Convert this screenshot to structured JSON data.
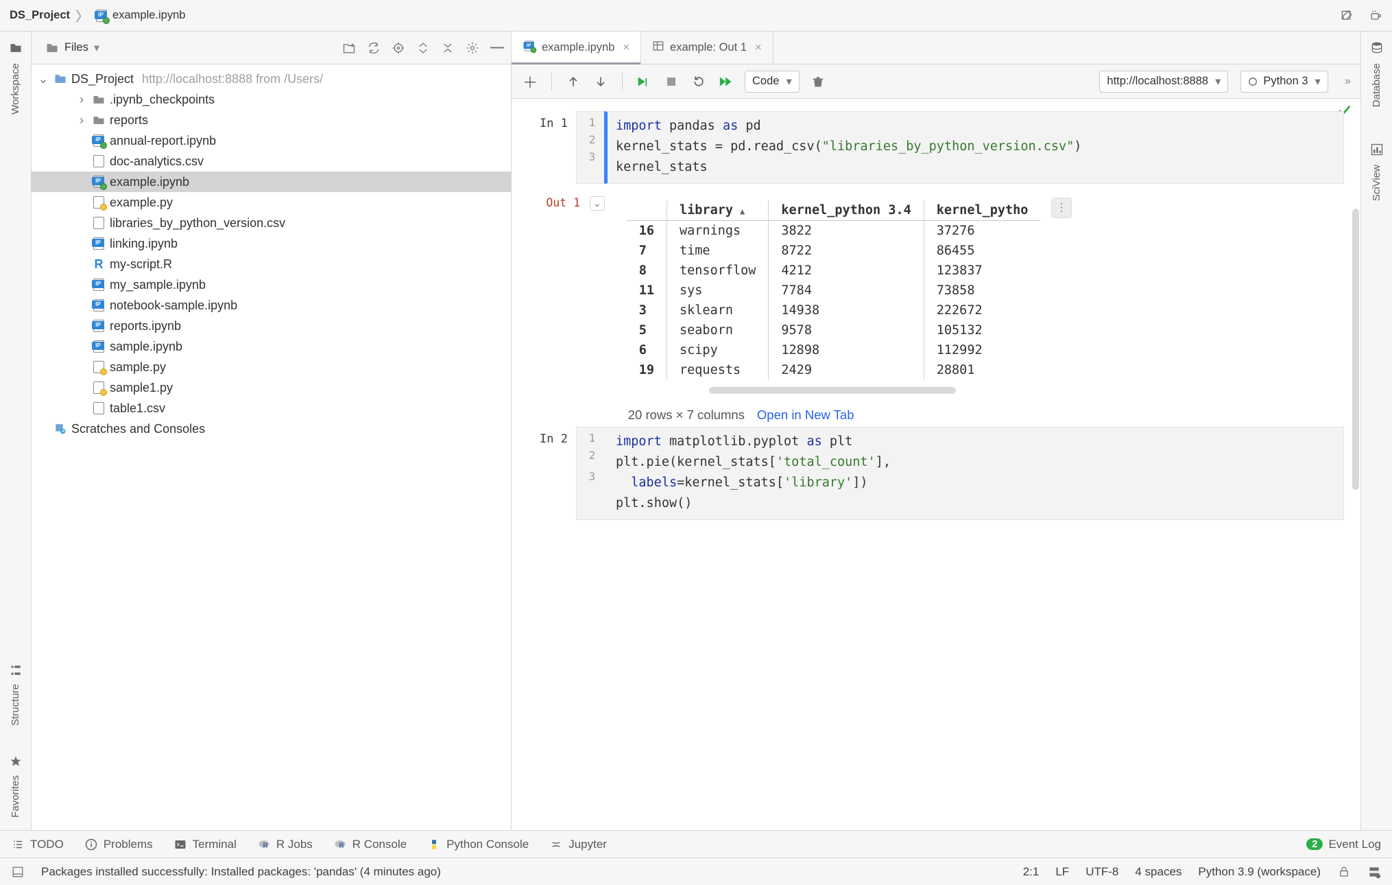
{
  "breadcrumbs": {
    "project": "DS_Project",
    "file": "example.ipynb"
  },
  "nav_icons": {
    "edit": "edit-icon",
    "tea": "tea-icon"
  },
  "left_gutter": [
    {
      "icon": "folder-icon",
      "label": "Workspace"
    },
    {
      "icon": "structure-icon",
      "label": "Structure"
    },
    {
      "icon": "star-icon",
      "label": "Favorites"
    }
  ],
  "right_gutter": [
    {
      "icon": "db-icon",
      "label": "Database"
    },
    {
      "icon": "sci-icon",
      "label": "SciView"
    }
  ],
  "files_panel": {
    "selector": "Files",
    "toolbar_icons": [
      "new-file-icon",
      "sync-icon",
      "target-icon",
      "expand-icon",
      "collapse-icon",
      "gear-icon",
      "hide-icon"
    ],
    "root": {
      "name": "DS_Project",
      "subtitle": "http://localhost:8888 from /Users/"
    },
    "tree": [
      {
        "type": "folder",
        "depth": 1,
        "name": ".ipynb_checkpoints",
        "arrow": "right"
      },
      {
        "type": "folder",
        "depth": 1,
        "name": "reports",
        "arrow": "right"
      },
      {
        "type": "ipynb-live",
        "depth": 1,
        "name": "annual-report.ipynb"
      },
      {
        "type": "csv",
        "depth": 1,
        "name": "doc-analytics.csv"
      },
      {
        "type": "ipynb-live",
        "depth": 1,
        "name": "example.ipynb",
        "selected": true
      },
      {
        "type": "py",
        "depth": 1,
        "name": "example.py"
      },
      {
        "type": "csv",
        "depth": 1,
        "name": "libraries_by_python_version.csv"
      },
      {
        "type": "ipynb",
        "depth": 1,
        "name": "linking.ipynb"
      },
      {
        "type": "r",
        "depth": 1,
        "name": "my-script.R"
      },
      {
        "type": "ipynb",
        "depth": 1,
        "name": "my_sample.ipynb"
      },
      {
        "type": "ipynb",
        "depth": 1,
        "name": "notebook-sample.ipynb"
      },
      {
        "type": "ipynb",
        "depth": 1,
        "name": "reports.ipynb"
      },
      {
        "type": "ipynb",
        "depth": 1,
        "name": "sample.ipynb"
      },
      {
        "type": "py",
        "depth": 1,
        "name": "sample.py"
      },
      {
        "type": "py",
        "depth": 1,
        "name": "sample1.py"
      },
      {
        "type": "csv",
        "depth": 1,
        "name": "table1.csv"
      }
    ],
    "scratches": "Scratches and Consoles"
  },
  "tabs": [
    {
      "icon": "ipynb",
      "label": "example.ipynb",
      "active": true,
      "closable": true
    },
    {
      "icon": "table",
      "label": "example: Out 1",
      "active": false,
      "closable": true
    }
  ],
  "nb_toolbar": {
    "buttons_left": [
      "add-cell",
      "",
      "move-up",
      "move-down",
      "",
      "run-cell",
      "stop",
      "restart",
      "run-all"
    ],
    "cell_type": "Code",
    "delete": "delete-cell",
    "server": "http://localhost:8888",
    "kernel": "Python 3",
    "more": "»"
  },
  "notebook": {
    "cells": [
      {
        "kind": "code",
        "prompt": "In 1",
        "active": true,
        "lines": [
          {
            "n": 1,
            "html": "<span class='kw'>import</span> pandas <span class='kw'>as</span> pd"
          },
          {
            "n": 2,
            "html": "kernel_stats = pd.read_csv(<span class='str'>\"libraries_by_python_version.csv\"</span>)"
          },
          {
            "n": 3,
            "html": "kernel_stats"
          }
        ]
      },
      {
        "kind": "out",
        "prompt": "Out 1",
        "table": {
          "columns": [
            "",
            "library",
            "kernel_python 3.4",
            "kernel_pytho"
          ],
          "sort_col": "library",
          "sort_dir": "asc",
          "rows": [
            [
              "16",
              "warnings",
              "3822",
              "37276"
            ],
            [
              "7",
              "time",
              "8722",
              "86455"
            ],
            [
              "8",
              "tensorflow",
              "4212",
              "123837"
            ],
            [
              "11",
              "sys",
              "7784",
              "73858"
            ],
            [
              "3",
              "sklearn",
              "14938",
              "222672"
            ],
            [
              "5",
              "seaborn",
              "9578",
              "105132"
            ],
            [
              "6",
              "scipy",
              "12898",
              "112992"
            ],
            [
              "19",
              "requests",
              "2429",
              "28801"
            ]
          ],
          "shape": "20 rows × 7 columns",
          "link": "Open in New Tab"
        }
      },
      {
        "kind": "code",
        "prompt": "In 2",
        "active": false,
        "lines": [
          {
            "n": 1,
            "html": "<span class='kw'>import</span> matplotlib.pyplot <span class='kw'>as</span> plt"
          },
          {
            "n": 2,
            "html": "plt.pie(kernel_stats[<span class='str'>'total_count'</span>],"
          },
          {
            "n": "",
            "html": "&nbsp;&nbsp;<span class='arg'>labels</span>=kernel_stats[<span class='str'>'library'</span>])"
          },
          {
            "n": 3,
            "html": "plt.show()"
          }
        ]
      }
    ]
  },
  "bottom_tools": [
    {
      "icon": "list",
      "label": "TODO"
    },
    {
      "icon": "info",
      "label": "Problems"
    },
    {
      "icon": "term",
      "label": "Terminal"
    },
    {
      "icon": "r",
      "label": "R Jobs"
    },
    {
      "icon": "r",
      "label": "R Console"
    },
    {
      "icon": "py",
      "label": "Python Console"
    },
    {
      "icon": "jup",
      "label": "Jupyter"
    }
  ],
  "event_log": {
    "count": "2",
    "label": "Event Log"
  },
  "status": {
    "msg": "Packages installed successfully: Installed packages: 'pandas' (4 minutes ago)",
    "caret": "2:1",
    "eol": "LF",
    "enc": "UTF-8",
    "indent": "4 spaces",
    "interp": "Python 3.9 (workspace)"
  }
}
